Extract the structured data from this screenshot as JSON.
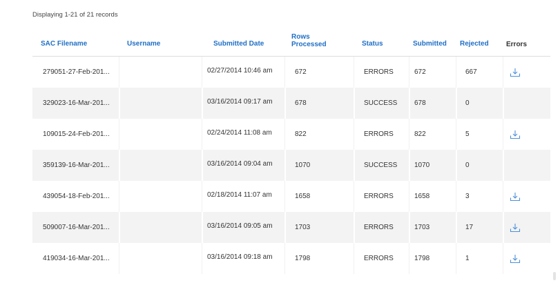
{
  "summary": "Displaying 1-21 of 21 records",
  "columns": {
    "sac_filename": "SAC Filename",
    "username": "Username",
    "submitted_date": "Submitted Date",
    "rows_processed": "Rows Processed",
    "status": "Status",
    "submitted": "Submitted",
    "rejected": "Rejected",
    "errors": "Errors"
  },
  "rows": [
    {
      "sac": "279051-27-Feb-201...",
      "user": "",
      "date": "02/27/2014 10:46 am",
      "rows": "672",
      "status": "ERRORS",
      "submitted": "672",
      "rejected": "667",
      "has_errors_download": true
    },
    {
      "sac": "329023-16-Mar-201...",
      "user": "",
      "date": "03/16/2014 09:17 am",
      "rows": "678",
      "status": "SUCCESS",
      "submitted": "678",
      "rejected": "0",
      "has_errors_download": false
    },
    {
      "sac": "109015-24-Feb-201...",
      "user": "",
      "date": "02/24/2014 11:08 am",
      "rows": "822",
      "status": "ERRORS",
      "submitted": "822",
      "rejected": "5",
      "has_errors_download": true
    },
    {
      "sac": "359139-16-Mar-201...",
      "user": "",
      "date": "03/16/2014 09:04 am",
      "rows": "1070",
      "status": "SUCCESS",
      "submitted": "1070",
      "rejected": "0",
      "has_errors_download": false
    },
    {
      "sac": "439054-18-Feb-201...",
      "user": "",
      "date": "02/18/2014 11:07 am",
      "rows": "1658",
      "status": "ERRORS",
      "submitted": "1658",
      "rejected": "3",
      "has_errors_download": true
    },
    {
      "sac": "509007-16-Mar-201...",
      "user": "",
      "date": "03/16/2014 09:05 am",
      "rows": "1703",
      "status": "ERRORS",
      "submitted": "1703",
      "rejected": "17",
      "has_errors_download": true
    },
    {
      "sac": "419034-16-Mar-201...",
      "user": "",
      "date": "03/16/2014 09:18 am",
      "rows": "1798",
      "status": "ERRORS",
      "submitted": "1798",
      "rejected": "1",
      "has_errors_download": true
    }
  ],
  "icons": {
    "download": "download-icon"
  },
  "colors": {
    "header_link": "#1f6fc5",
    "icon_blue": "#4a90d9",
    "row_alt": "#f3f3f3"
  }
}
